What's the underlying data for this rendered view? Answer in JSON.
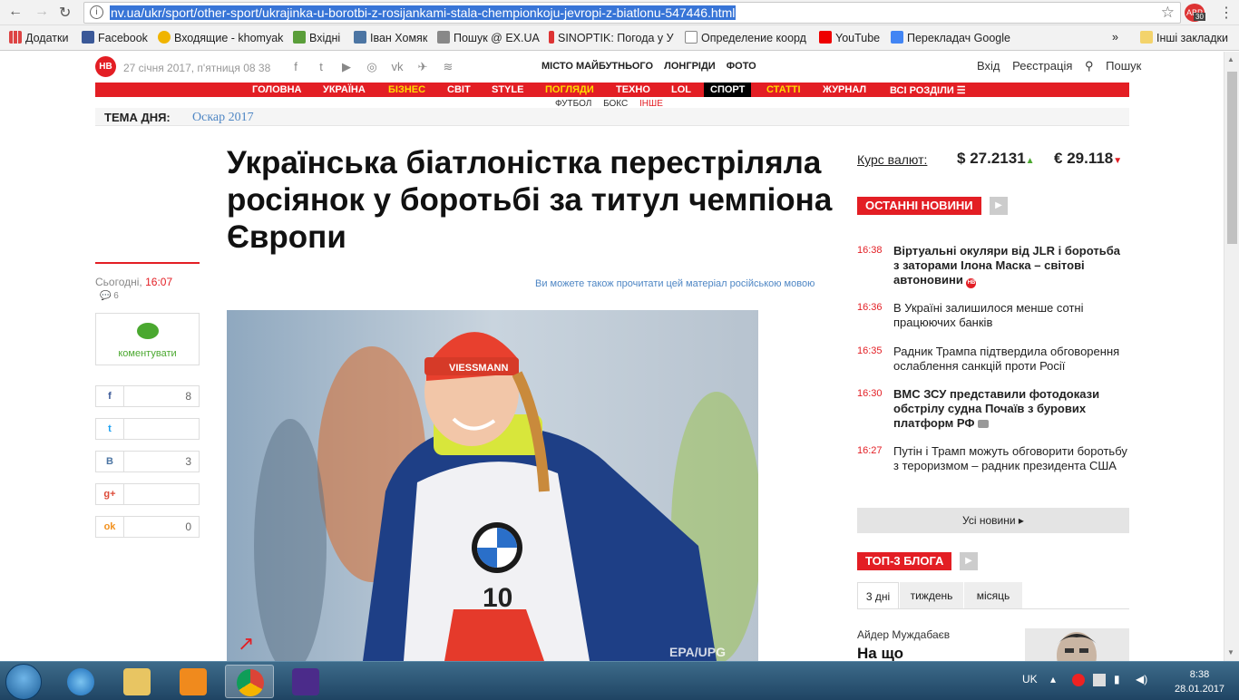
{
  "browser": {
    "url": "nv.ua/ukr/sport/other-sport/ukrajinka-u-borotbi-z-rosijankami-stala-chempionkoju-jevropi-z-biatlonu-547446.html",
    "ext_badge": "30",
    "ext_label": "ABP"
  },
  "bookmarks": {
    "items": [
      {
        "label": "Додатки"
      },
      {
        "label": "Facebook"
      },
      {
        "label": "Входящие - khomyak"
      },
      {
        "label": "Вхідні"
      },
      {
        "label": "Іван Хомяк"
      },
      {
        "label": "Пошук @ EX.UA"
      },
      {
        "label": "SINOPTIK: Погода у У"
      },
      {
        "label": "Определение коорд"
      },
      {
        "label": "YouTube"
      },
      {
        "label": "Перекладач Google"
      }
    ],
    "more": "»",
    "other": "Інші закладки"
  },
  "site": {
    "logo": "НВ",
    "date": "27 січня 2017, п'ятниця 08 38",
    "top_nav": [
      "МІСТО МАЙБУТНЬОГО",
      "ЛОНГРІДИ",
      "ФОТО"
    ],
    "login": "Вхід",
    "register": "Реєстрація",
    "search": "Пошук",
    "main_nav": [
      {
        "label": "ГОЛОВНА"
      },
      {
        "label": "УКРАЇНА"
      },
      {
        "label": "БІЗНЕС"
      },
      {
        "label": "СВІТ"
      },
      {
        "label": "STYLE"
      },
      {
        "label": "ПОГЛЯДИ"
      },
      {
        "label": "ТЕХНО"
      },
      {
        "label": "LOL"
      },
      {
        "label": "СПОРТ"
      },
      {
        "label": "СТАТТІ"
      },
      {
        "label": "ЖУРНАЛ"
      },
      {
        "label": "ВСІ РОЗДІЛИ ☰"
      }
    ],
    "sub_nav": [
      "ФУТБОЛ",
      "БОКС",
      "ІНШЕ"
    ],
    "topic_label": "ТЕМА ДНЯ:",
    "topic_link": "Оскар 2017"
  },
  "article": {
    "headline": "Українська біатлоністка перестріляла росіянок у боротьбі за титул чемпіона Європи",
    "pub_day": "Сьогодні,",
    "pub_time": "16:07",
    "comments_count": "6",
    "comment_button": "коментувати",
    "read_ru": "Ви можете також прочитати цей матеріал російською мовою",
    "share": [
      {
        "network": "facebook",
        "count": "8"
      },
      {
        "network": "twitter",
        "count": ""
      },
      {
        "network": "vkontakte",
        "count": "3"
      },
      {
        "network": "google-plus",
        "count": ""
      },
      {
        "network": "odnoklassniki",
        "count": "0"
      }
    ],
    "photo_watermark": "EPA/UPG",
    "bib_number": "10"
  },
  "rates": {
    "label": "Курс валют:",
    "usd_symbol": "$",
    "usd": "27.2131",
    "eur_symbol": "€",
    "eur": "29.118"
  },
  "latest": {
    "title": "ОСТАННІ НОВИНИ",
    "items": [
      {
        "time": "16:38",
        "text": "Віртуальні окуляри від JLR і боротьба з заторами Ілона Маска – світові автоновини"
      },
      {
        "time": "16:36",
        "text": "В Україні залишилося менше сотні працюючих банків"
      },
      {
        "time": "16:35",
        "text": "Радник Трампа підтвердила обговорення ослаблення санкцій проти Росії"
      },
      {
        "time": "16:30",
        "text": "ВМС ЗСУ представили фотодокази обстрілу судна Почаїв з бурових платформ РФ"
      },
      {
        "time": "16:27",
        "text": "Путін і Трамп можуть обговорити боротьбу з тероризмом – радник президента США"
      }
    ],
    "all_news": "Усі новини ▸"
  },
  "blogs": {
    "title": "ТОП-3 БЛОГА",
    "tabs": [
      "3 дні",
      "тиждень",
      "місяць"
    ],
    "author": "Айдер Муждабаєв",
    "post_title": "На що"
  },
  "taskbar": {
    "lang": "UK",
    "time": "8:38",
    "date": "28.01.2017"
  },
  "colors": {
    "brand_red": "#e31e24",
    "link_blue": "#4e86c4",
    "green": "#4aa82f"
  }
}
